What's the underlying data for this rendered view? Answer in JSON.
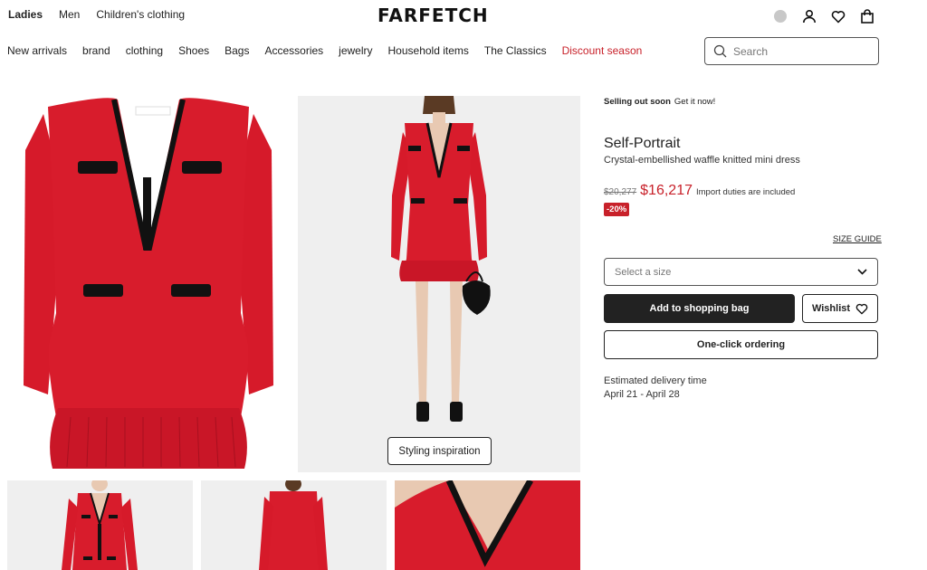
{
  "header": {
    "gender_tabs": [
      "Ladies",
      "Men",
      "Children's clothing"
    ],
    "logo": "FARFETCH"
  },
  "categories": [
    "New arrivals",
    "brand",
    "clothing",
    "Shoes",
    "Bags",
    "Accessories",
    "jewelry",
    "Household items",
    "The Classics",
    "Discount season"
  ],
  "search": {
    "placeholder": "Search"
  },
  "icons": [
    "region-indicator-icon",
    "account-icon",
    "wishlist-heart-icon",
    "shopping-bag-icon",
    "search-icon",
    "chevron-down-icon",
    "heart-icon"
  ],
  "gallery": {
    "styling_label": "Styling inspiration"
  },
  "product": {
    "urgency_bold": "Selling out soon",
    "urgency_text": "Get it now!",
    "brand": "Self-Portrait",
    "name": "Crystal-embellished waffle knitted mini dress",
    "old_price": "$20,277",
    "new_price": "$16,217",
    "duties": "Import duties are included",
    "discount": "-20%",
    "size_guide": "SIZE GUIDE",
    "size_placeholder": "Select a size",
    "add_to_bag": "Add to shopping bag",
    "wishlist": "Wishlist",
    "one_click": "One-click ordering",
    "delivery_label": "Estimated delivery time",
    "delivery_dates": "April 21 - April 28"
  },
  "colors": {
    "accent_red": "#c8212a",
    "dark": "#222222"
  }
}
